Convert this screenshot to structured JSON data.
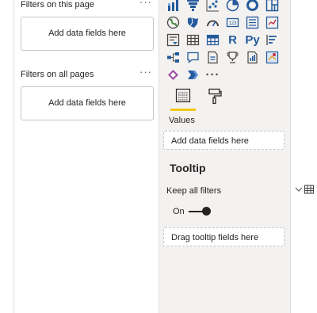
{
  "filters": {
    "this_page": {
      "title": "Filters on this page",
      "drop_label": "Add data fields here"
    },
    "all_pages": {
      "title": "Filters on all pages",
      "drop_label": "Add data fields here"
    },
    "more_label": "···"
  },
  "visualizations": {
    "icons": [
      "stacked-column-chart-icon",
      "funnel-chart-icon",
      "scatter-chart-icon",
      "pie-chart-icon",
      "donut-chart-icon",
      "treemap-icon",
      "map-icon",
      "filled-map-icon",
      "gauge-icon",
      "card-icon",
      "multi-row-card-icon",
      "kpi-icon",
      "slicer-icon",
      "table-icon",
      "matrix-icon",
      "r-visual-icon",
      "python-visual-icon",
      "key-influencers-icon",
      "decomposition-tree-icon",
      "qa-icon",
      "paginated-report-icon",
      "goals-icon",
      "smart-narrative-icon",
      "azure-map-icon",
      "power-apps-icon",
      "power-automate-icon",
      "more-visuals-icon"
    ],
    "r_glyph": "R",
    "py_glyph": "Py",
    "more_glyph": "···",
    "tabs": [
      "fields-tab",
      "format-tab"
    ]
  },
  "values": {
    "label": "Values",
    "placeholder": "Add data fields here"
  },
  "tooltip": {
    "heading": "Tooltip",
    "keep_all_filters_label": "Keep all filters",
    "toggle_state": "On",
    "drag_placeholder": "Drag tooltip fields here"
  },
  "colors": {
    "accent": "#f2c811",
    "pane_bg": "#f3f2f1",
    "icon_blue": "#255a9c"
  }
}
